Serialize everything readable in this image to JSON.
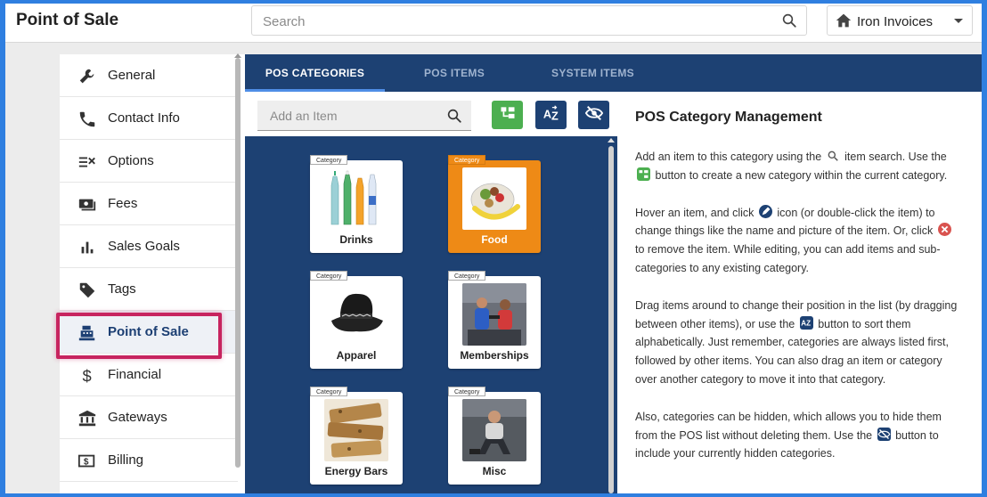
{
  "header": {
    "app_title": "Point of Sale",
    "search_placeholder": "Search",
    "account_name": "Iron Invoices"
  },
  "sidebar": {
    "items": [
      {
        "label": "General",
        "icon": "wrench-icon"
      },
      {
        "label": "Contact Info",
        "icon": "phone-icon"
      },
      {
        "label": "Options",
        "icon": "options-list-icon"
      },
      {
        "label": "Fees",
        "icon": "cash-icon"
      },
      {
        "label": "Sales Goals",
        "icon": "bar-chart-icon"
      },
      {
        "label": "Tags",
        "icon": "tag-icon"
      },
      {
        "label": "Point of Sale",
        "icon": "cash-register-icon"
      },
      {
        "label": "Financial",
        "icon": "dollar-icon"
      },
      {
        "label": "Gateways",
        "icon": "bank-icon"
      },
      {
        "label": "Billing",
        "icon": "billing-icon"
      }
    ],
    "active": "Point of Sale"
  },
  "tabs": [
    {
      "label": "POS CATEGORIES",
      "active": true
    },
    {
      "label": "POS ITEMS",
      "active": false
    },
    {
      "label": "SYSTEM ITEMS",
      "active": false
    }
  ],
  "toolbar": {
    "add_item_placeholder": "Add an Item",
    "buttons": [
      {
        "name": "new-category",
        "icon": "new-category-icon",
        "color": "#4caf50"
      },
      {
        "name": "sort-az",
        "icon": "sort-az-icon",
        "color": "#1d4173"
      },
      {
        "name": "show-hidden",
        "icon": "eye-off-icon",
        "color": "#1d4173"
      }
    ]
  },
  "categories": [
    {
      "badge": "Category",
      "label": "Drinks",
      "image": "bottles",
      "selected": false
    },
    {
      "badge": "Category",
      "label": "Food",
      "image": "food-bowl",
      "selected": true
    },
    {
      "badge": "Category",
      "label": "Apparel",
      "image": "hat",
      "selected": false
    },
    {
      "badge": "Category",
      "label": "Memberships",
      "image": "gym-people",
      "selected": false
    },
    {
      "badge": "Category",
      "label": "Energy Bars",
      "image": "bars",
      "selected": false
    },
    {
      "badge": "Category",
      "label": "Misc",
      "image": "gym-man",
      "selected": false
    }
  ],
  "info": {
    "title": "POS Category Management",
    "p1a": "Add an item to this category using the",
    "p1b": "item search. Use the",
    "p1c": "button to create a new category within the current category.",
    "p2a": "Hover an item, and click",
    "p2b": "icon (or double-click the item) to change things like the name and picture of the item. Or, click",
    "p2c": "to remove the item. While editing, you can add items and sub-categories to any existing category.",
    "p3a": "Drag items around to change their position in the list (by dragging between other items), or use the",
    "p3b": "button to sort them alphabetically. Just remember, categories are always listed first, followed by other items. You can also drag an item or category over another category to move it into that category.",
    "p4a": "Also, categories can be hidden, which allows you to hide them from the POS list without deleting them. Use the",
    "p4b": "button to include your currently hidden categories."
  },
  "colors": {
    "accent_navy": "#1d4173",
    "selected_orange": "#ee8a16",
    "highlight_pink": "#c7245f",
    "frame_blue": "#2f7fe0"
  }
}
